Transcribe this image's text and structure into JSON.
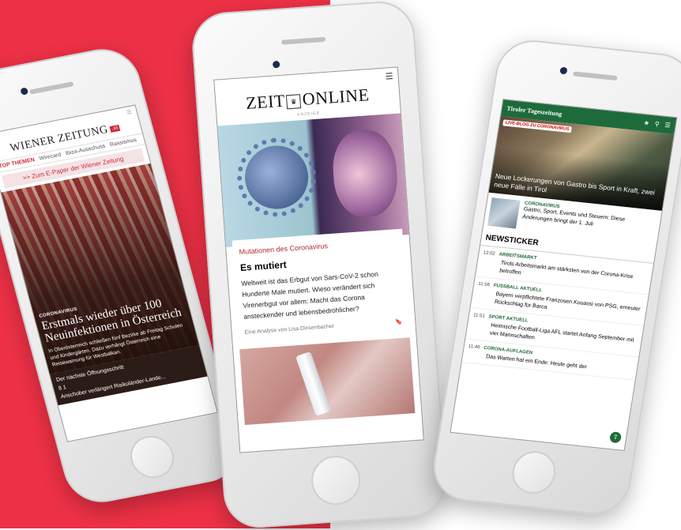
{
  "colors": {
    "brand_red": "#ee3146",
    "wz_red": "#d22a39",
    "zeit_red": "#b3282d",
    "tt_green": "#1d6b3a"
  },
  "wiener_zeitung": {
    "logo": "WIENER ZEITUNG",
    "logo_badge": ".at",
    "nav": [
      "TOP THEMEN",
      "Wirecard",
      "Ibiza-Ausschuss",
      "Rassismus"
    ],
    "epaper": ">> Zum E-Paper der Wiener Zeitung",
    "kicker": "CORONAVIRUS",
    "headline": "Erstmals wieder über 100 Neuinfektionen in Österreich",
    "teaser": "In Oberösterreich schließen fünf Bezirke ab Freitag Schulen und Kindergärten. Dazu verhängt Österreich eine Reisewarnung für Westbalkan.",
    "list": [
      "Der nächste Öffnungsschritt",
      "Anschober verlängert Risikoländer-Lande..."
    ],
    "counts": "8 1"
  },
  "zeit_online": {
    "logo_left": "ZEIT",
    "logo_right": "ONLINE",
    "ad_label": "ANZEIGE",
    "kicker": "Mutationen des Coronavirus",
    "title": "Es mutiert",
    "text": "Weltweit ist das Erbgut von Sars-CoV-2 schon Hunderte Male mutiert. Wieso verändert sich Virenerbgut vor allem: Macht das Corona ansteckender und lebensbedrohlicher?",
    "byline": "Eine Analyse von Lisa Dinsenbacher"
  },
  "tiroler_tageszeitung": {
    "logo": "Tiroler Tageszeitung",
    "live_label": "LIVE-BLOG ZU CORONAVIRUS",
    "hero_headline": "Neue Lockerungen von Gastro bis Sport in Kraft, zwei neue Fälle in Tirol",
    "item_kicker": "CORONAVIRUS",
    "item_text": "Gastro, Sport, Events und Steuern: Diese Änderungen bringt der 1. Juli",
    "section": "NEWSTICKER",
    "news": [
      {
        "time": "12:02",
        "cat": "ARBEITSMARKT",
        "text": "Tirols Arbeitsmarkt am stärksten von der Corona-Krise betroffen"
      },
      {
        "time": "11:56",
        "cat": "FUSSBALL AKTUELL",
        "text": "Bayern verpflichtete Franzosen Kouassi von PSG, erneuter Rückschlag für Barca"
      },
      {
        "time": "11:51",
        "cat": "SPORT AKTUELL",
        "text": "Heimische Football-Liga AFL startet Anfang September mit vier Mannschaften"
      },
      {
        "time": "11:46",
        "cat": "CORONA-AUFLAGEN",
        "text": "Das Warten hat ein Ende: Heute geht der"
      }
    ]
  }
}
